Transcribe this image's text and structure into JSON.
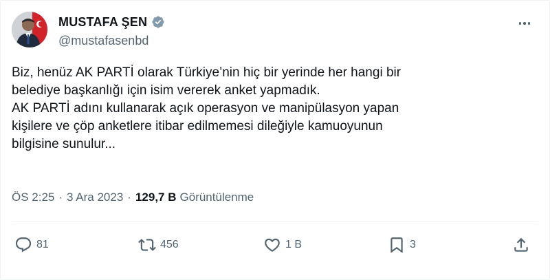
{
  "author": {
    "display_name": "MUSTAFA ŞEN",
    "handle": "@mustafasenbd",
    "verified_icon": "verified-badge-icon"
  },
  "tweet": {
    "lines": [
      "Biz, henüz AK PARTİ olarak Türkiye’nin hiç bir yerinde her hangi bir",
      "belediye başkanlığı için isim vererek anket yapmadık.",
      "AK PARTİ adını kullanarak açık operasyon ve manipülasyon yapan",
      "kişilere ve çöp anketlere itibar edilmemesi dileğiyle kamuoyunun",
      "bilgisine sunulur..."
    ]
  },
  "meta": {
    "time": "ÖS 2:25",
    "separator": "·",
    "date": "3 Ara 2023",
    "views_count": "129,7 B",
    "views_label": "Görüntülenme"
  },
  "actions": {
    "reply": {
      "icon": "reply-icon",
      "count": "81"
    },
    "retweet": {
      "icon": "retweet-icon",
      "count": "456"
    },
    "like": {
      "icon": "heart-icon",
      "count": "1 B"
    },
    "bookmark": {
      "icon": "bookmark-icon",
      "count": "3"
    },
    "share": {
      "icon": "share-icon"
    }
  },
  "colors": {
    "text_primary": "#0f1419",
    "text_secondary": "#536471",
    "verified": "#829aab",
    "border": "#eff3f4"
  }
}
